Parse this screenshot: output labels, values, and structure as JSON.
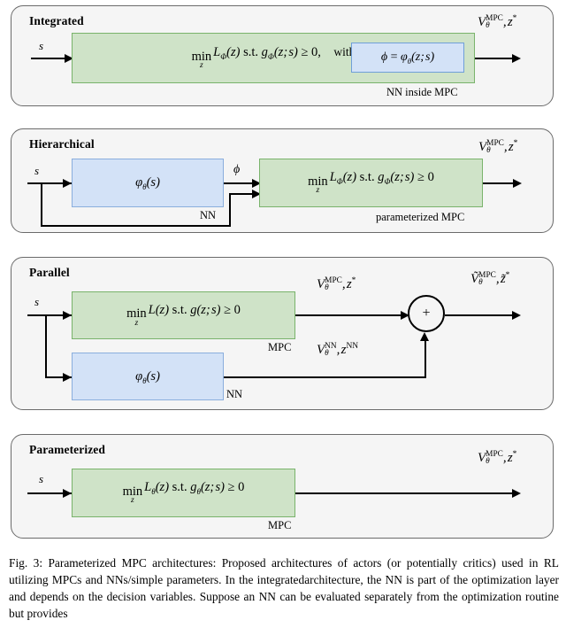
{
  "figure": {
    "caption": "Fig. 3: Parameterized MPC architectures: Proposed architectures of actors (or potentially critics) used in RL utilizing MPCs and NNs/simple parameters. In the integratedarchitecture, the NN is part of the optimization layer and depends on the decision variables. Suppose an NN can be evaluated separately from the optimization routine but provides"
  },
  "colors": {
    "panel_background": "#f5f5f5",
    "panel_border": "#6b6b6b",
    "mpc_fill": "#cfe3c8",
    "mpc_border": "#79b36b",
    "nn_fill": "#d3e2f7",
    "nn_border": "#8aaedd",
    "wire": "#000000",
    "page_background": "#ffffff"
  },
  "panels": [
    {
      "id": "integrated",
      "title": "Integrated",
      "input_label": "s",
      "mpc_block": {
        "formula_min": "min",
        "formula_min_sub": "z",
        "formula_objective": "L",
        "formula_objective_sub": "φ",
        "formula_objective_arg": "(z)",
        "formula_st": "s.t.",
        "formula_constraint": "g",
        "formula_constraint_sub": "φ",
        "formula_constraint_arg": "(z; s)",
        "formula_relation": "≥ 0,",
        "formula_with": "with",
        "text_plain": "min_z L_φ(z) s.t. g_φ(z; s) ≥ 0,   with"
      },
      "inner_nn_block": {
        "text_plain": "φ = φ_θ(z; s)",
        "lhs": "φ",
        "eq": "=",
        "rhs_fn": "φ",
        "rhs_sub": "θ",
        "rhs_arg": "(z; s)"
      },
      "sublabel": "NN inside MPC",
      "output_label": {
        "v": "V",
        "sup": "MPC",
        "sub": "θ",
        "rest": ", z*",
        "text_plain": "V_θ^MPC, z*"
      }
    },
    {
      "id": "hierarchical",
      "title": "Hierarchical",
      "input_label": "s",
      "nn_block": {
        "fn": "φ",
        "sub": "θ",
        "arg": "(s)",
        "text_plain": "φ_θ(s)"
      },
      "nn_sublabel": "NN",
      "mid_label": "φ",
      "mpc_block": {
        "text_plain": "min_z L_φ(z) s.t. g_φ(z; s) ≥ 0"
      },
      "mpc_sublabel": "parameterized MPC",
      "output_label": {
        "v": "V",
        "sup": "MPC",
        "sub": "θ",
        "rest": ", z*",
        "text_plain": "V_θ^MPC, z*"
      }
    },
    {
      "id": "parallel",
      "title": "Parallel",
      "input_label": "s",
      "mpc_block": {
        "text_plain": "min_z L(z) s.t. g(z; s) ≥ 0"
      },
      "mpc_sublabel": "MPC",
      "nn_block": {
        "fn": "φ",
        "sub": "θ",
        "arg": "(s)",
        "text_plain": "φ_θ(s)"
      },
      "nn_sublabel": "NN",
      "mpc_signal": {
        "v": "V",
        "sup": "MPC",
        "sub": "θ",
        "rest": ", z*",
        "text_plain": "V_θ^MPC, z*"
      },
      "nn_signal": {
        "v": "V",
        "sup": "NN",
        "sub": "θ",
        "rest": ", z",
        "rest_sup": "NN",
        "text_plain": "V_θ^NN, z^NN"
      },
      "sum_symbol": "+",
      "output_label": {
        "v": "Ṽ",
        "sup": "MPC",
        "sub": "θ",
        "rest": ", z̃*",
        "text_plain": "Ṽ_θ^MPC, z̃*"
      }
    },
    {
      "id": "parameterized",
      "title": "Parameterized",
      "input_label": "s",
      "mpc_block": {
        "text_plain": "min_z L_θ(z) s.t. g_θ(z; s) ≥ 0"
      },
      "mpc_sublabel": "MPC",
      "output_label": {
        "v": "V",
        "sup": "MPC",
        "sub": "θ",
        "rest": ", z*",
        "text_plain": "V_θ^MPC, z*"
      }
    }
  ]
}
